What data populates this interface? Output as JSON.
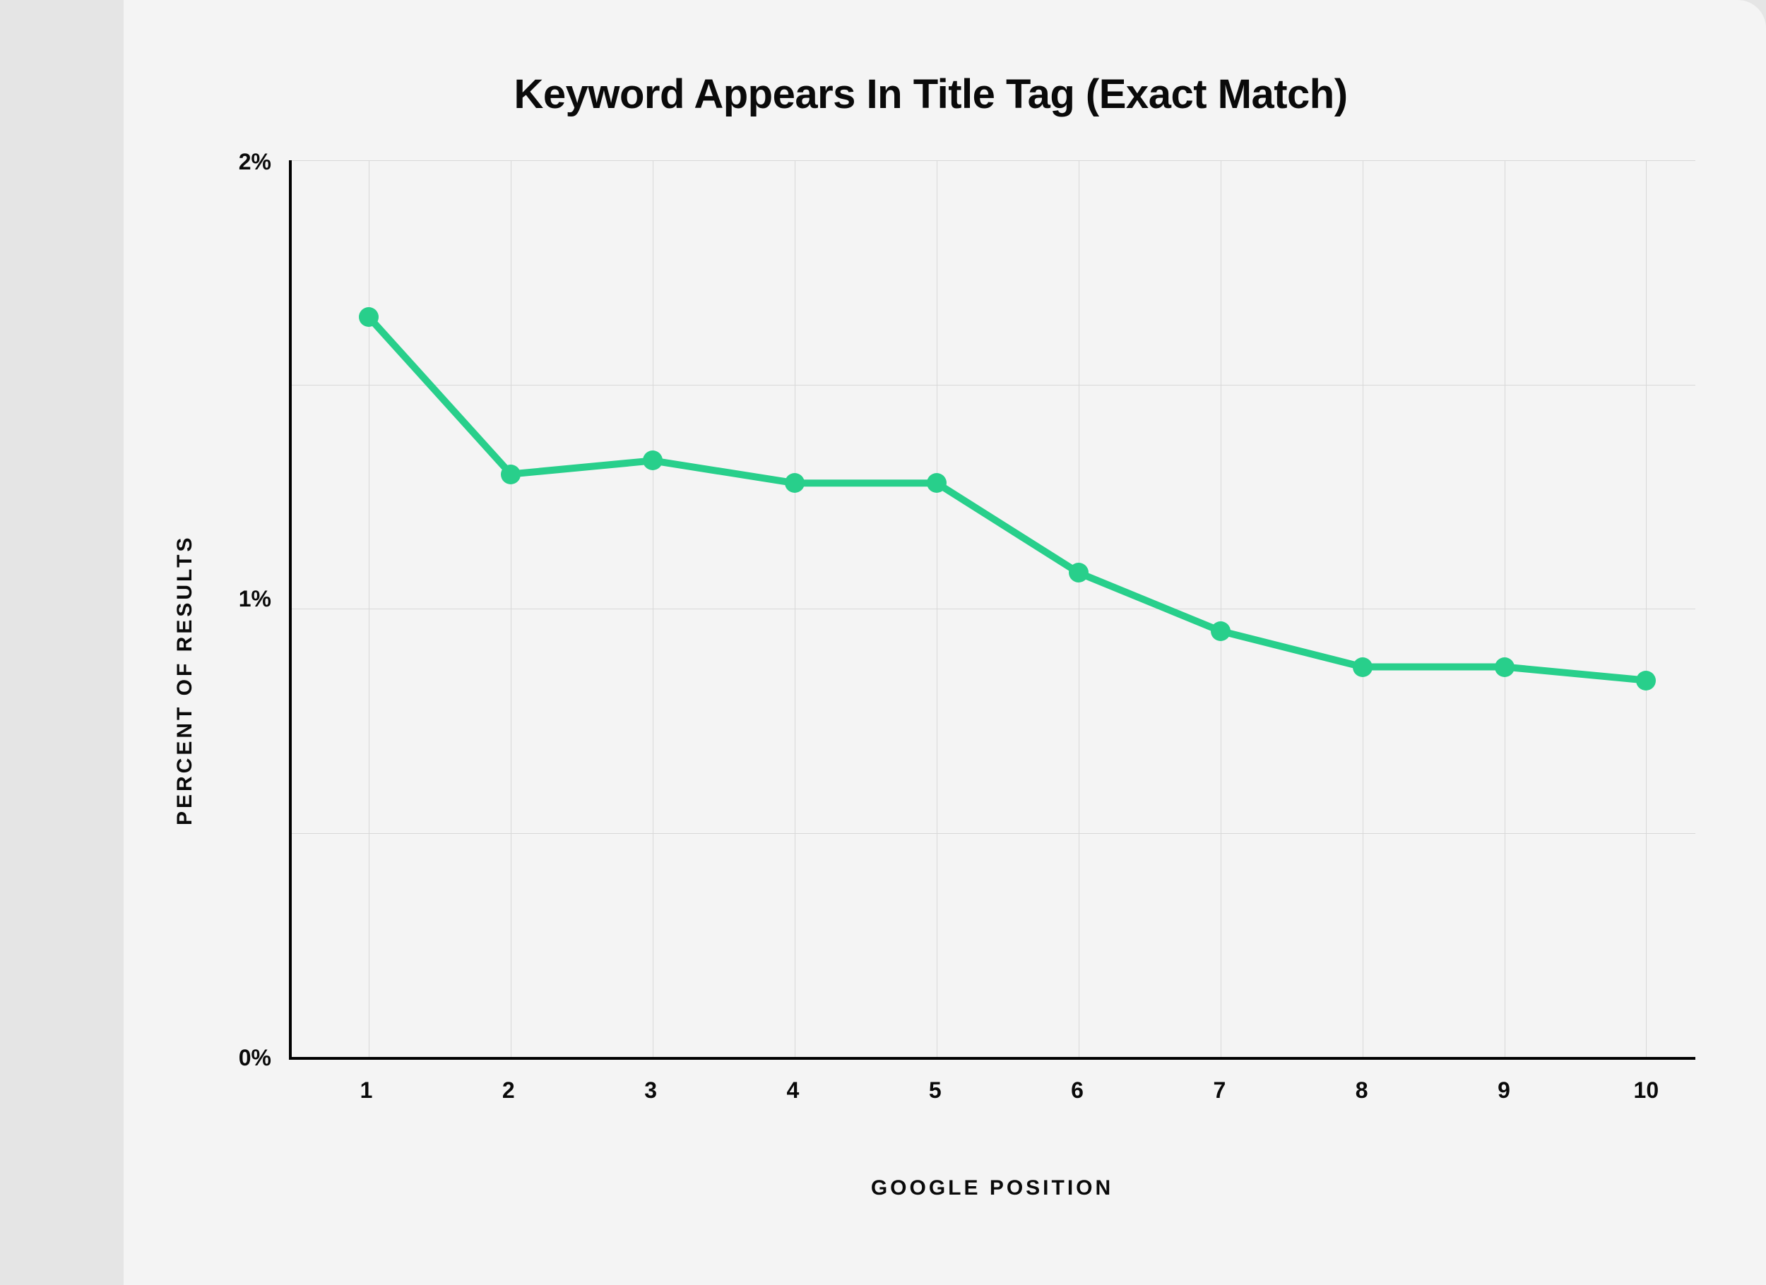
{
  "chart_data": {
    "type": "line",
    "title": "Keyword Appears In Title Tag (Exact Match)",
    "xlabel": "GOOGLE POSITION",
    "ylabel": "PERCENT OF RESULTS",
    "x": [
      1,
      2,
      3,
      4,
      5,
      6,
      7,
      8,
      9,
      10
    ],
    "values": [
      1.65,
      1.3,
      1.33,
      1.28,
      1.28,
      1.08,
      0.95,
      0.87,
      0.87,
      0.84
    ],
    "ylim": [
      0,
      2
    ],
    "y_ticks": [
      "2%",
      "1%",
      "0%"
    ],
    "x_ticks": [
      "1",
      "2",
      "3",
      "4",
      "5",
      "6",
      "7",
      "8",
      "9",
      "10"
    ],
    "line_color": "#28cf8b",
    "grid": true
  }
}
